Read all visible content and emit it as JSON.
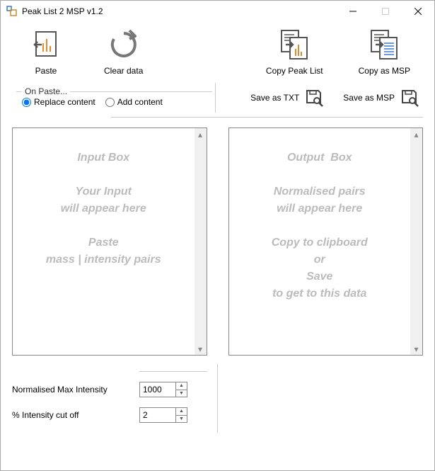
{
  "window": {
    "title": "Peak List 2 MSP v1.2"
  },
  "toolbar": {
    "paste": "Paste",
    "clear": "Clear data",
    "copy_peak": "Copy Peak List",
    "copy_msp": "Copy as MSP"
  },
  "paste_group": {
    "title": "On Paste...",
    "replace": "Replace content",
    "add": "Add content"
  },
  "save": {
    "txt": "Save as TXT",
    "msp": "Save as MSP"
  },
  "input_placeholder": "Input Box\n\nYour Input\nwill appear here\n\nPaste\nmass | intensity pairs",
  "output_placeholder": "Output  Box\n\nNormalised pairs\nwill appear here\n\nCopy to clipboard\nor\nSave\nto get to this data",
  "settings": {
    "max_label": "Normalised Max Intensity",
    "max_value": "1000",
    "cutoff_label": "% Intensity cut off",
    "cutoff_value": "2"
  }
}
